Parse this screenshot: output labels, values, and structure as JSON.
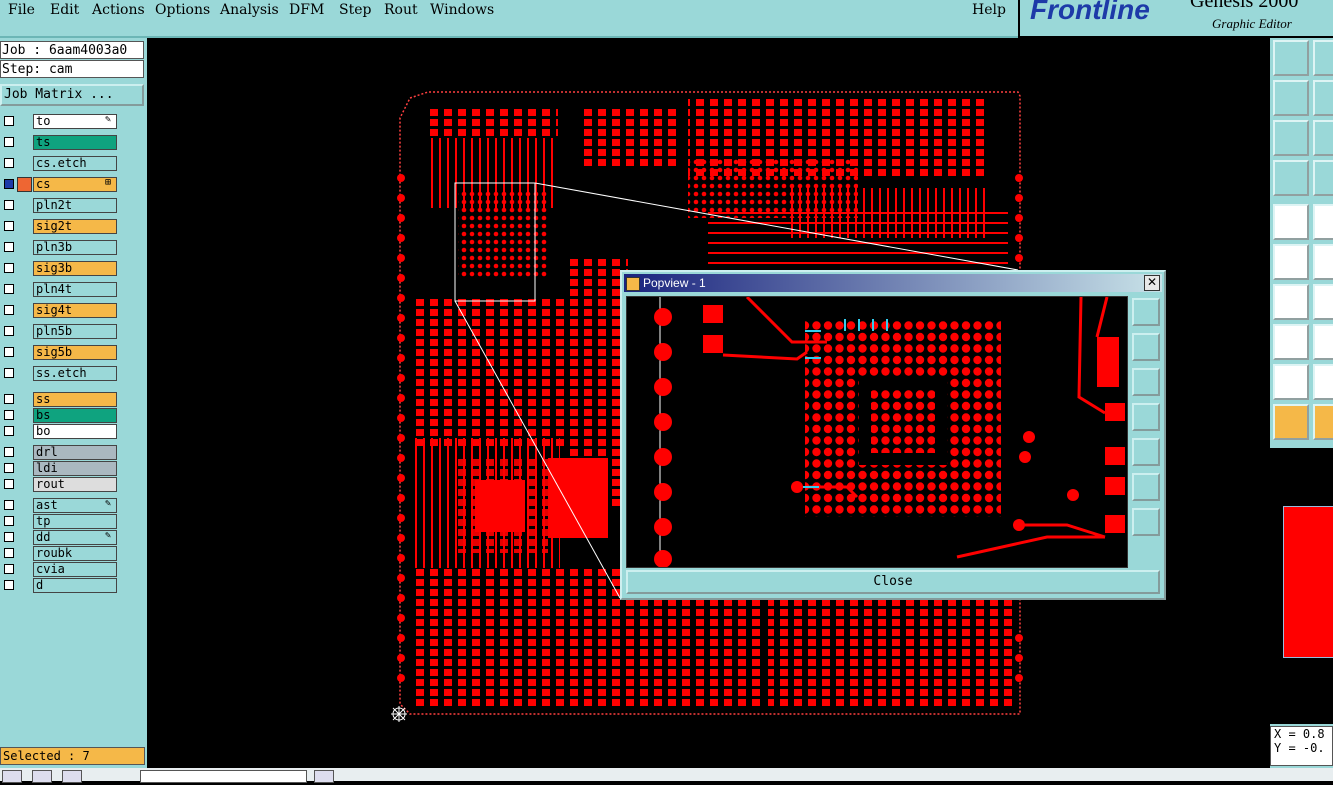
{
  "menubar": {
    "items": [
      "File",
      "Edit",
      "Actions",
      "Options",
      "Analysis",
      "DFM",
      "Step",
      "Rout",
      "Windows"
    ],
    "help": "Help"
  },
  "logo": {
    "brand": "Frontline",
    "product": "Genesis 2000",
    "subtitle": "Graphic Editor"
  },
  "job": {
    "job_label": "Job : 6aam4003a0",
    "step_label": "Step: cam",
    "matrix_button": "Job Matrix ..."
  },
  "layers": [
    {
      "name": "to",
      "color": "#ffffff",
      "mark": "✎"
    },
    {
      "name": "ts",
      "color": "#0fa37f",
      "mark": ""
    },
    {
      "name": "cs.etch",
      "color": "#9ad8d8",
      "mark": ""
    },
    {
      "name": "cs",
      "color": "#f5b848",
      "mark": "⊞",
      "active": true
    },
    {
      "name": "pln2t",
      "color": "#9ad8d8",
      "mark": ""
    },
    {
      "name": "sig2t",
      "color": "#f5b848",
      "mark": ""
    },
    {
      "name": "pln3b",
      "color": "#9ad8d8",
      "mark": ""
    },
    {
      "name": "sig3b",
      "color": "#f5b848",
      "mark": ""
    },
    {
      "name": "pln4t",
      "color": "#9ad8d8",
      "mark": ""
    },
    {
      "name": "sig4t",
      "color": "#f5b848",
      "mark": ""
    },
    {
      "name": "pln5b",
      "color": "#9ad8d8",
      "mark": ""
    },
    {
      "name": "sig5b",
      "color": "#f5b848",
      "mark": ""
    },
    {
      "name": "ss.etch",
      "color": "#9ad8d8",
      "mark": ""
    },
    {
      "name": "ss",
      "color": "#f5b848",
      "mark": ""
    },
    {
      "name": "bs",
      "color": "#0fa37f",
      "mark": ""
    },
    {
      "name": "bo",
      "color": "#ffffff",
      "mark": ""
    },
    {
      "name": "drl",
      "color": "#aab8c0",
      "mark": ""
    },
    {
      "name": "ldi",
      "color": "#aab8c0",
      "mark": ""
    },
    {
      "name": "rout",
      "color": "#dddddd",
      "mark": ""
    },
    {
      "name": "ast",
      "color": "#9ad8d8",
      "mark": "✎"
    },
    {
      "name": "tp",
      "color": "#9ad8d8",
      "mark": ""
    },
    {
      "name": "dd",
      "color": "#9ad8d8",
      "mark": "✎"
    },
    {
      "name": "roubk",
      "color": "#9ad8d8",
      "mark": ""
    },
    {
      "name": "cvia",
      "color": "#9ad8d8",
      "mark": ""
    },
    {
      "name": "d",
      "color": "#9ad8d8",
      "mark": ""
    }
  ],
  "status": {
    "selected": "Selected : 7"
  },
  "popview": {
    "title": "Popview - 1",
    "close_button": "Close",
    "close_x": "✕"
  },
  "coords": {
    "x": "X = 0.8",
    "y": "Y = -0."
  },
  "colors": {
    "board": "#ff0000",
    "panel": "#9ad8d8",
    "highlight": "#f5b848"
  }
}
